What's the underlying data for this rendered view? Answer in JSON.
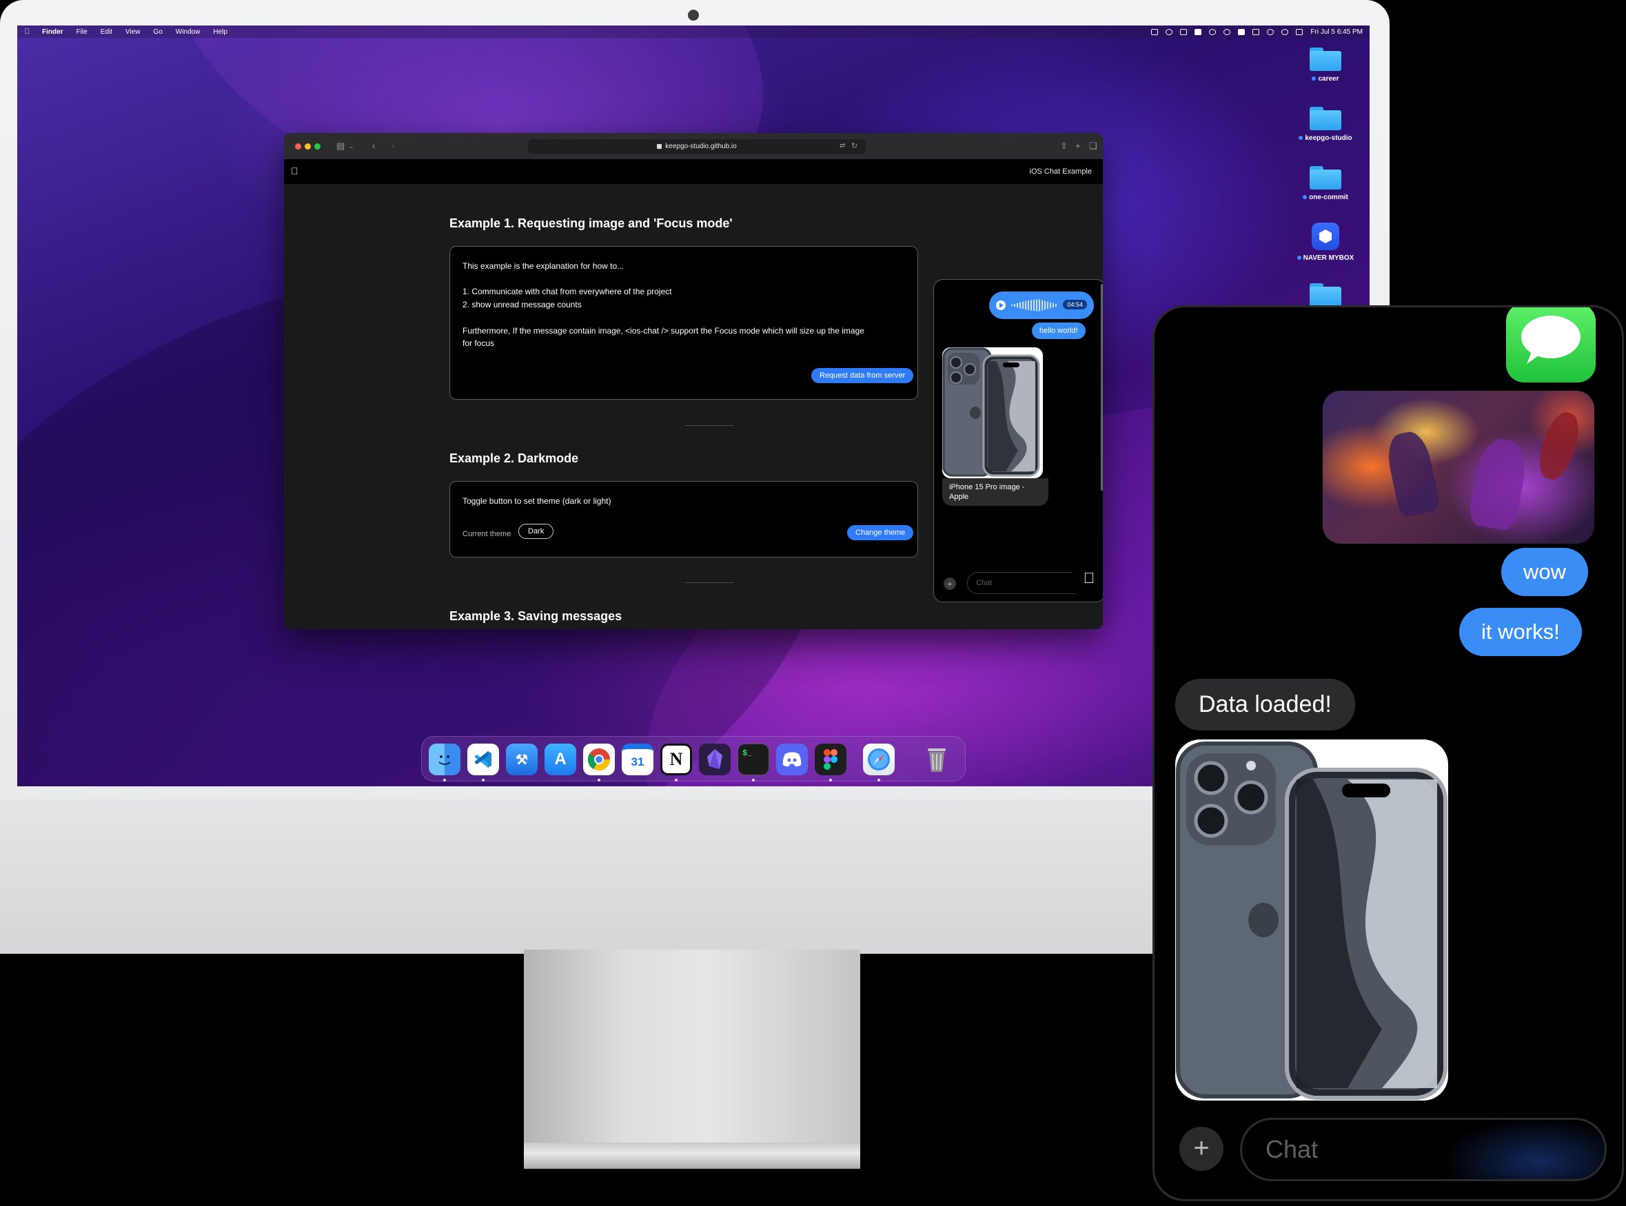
{
  "menubar": {
    "app": "Finder",
    "items": [
      "File",
      "Edit",
      "View",
      "Go",
      "Window",
      "Help"
    ],
    "clock": "Fri Jul 5  6:45 PM"
  },
  "desktop": {
    "items": [
      "career",
      "keepgo-studio",
      "one-commit",
      "NAVER MYBOX"
    ]
  },
  "safari": {
    "url": "keepgo-studio.github.io",
    "nav_title": "iOS Chat Example"
  },
  "examples": {
    "ex1": {
      "heading": "Example 1. Requesting image and 'Focus mode'",
      "line1": "This example is the explanation for how to...",
      "line2": "1. Communicate with chat from everywhere of the project",
      "line3": "2. show unread message counts",
      "line4": "Furthermore, If the message contain image, <ios-chat /> support the Focus mode which will size up the image",
      "line5": "for focus",
      "button": "Request data from server"
    },
    "ex2": {
      "heading": "Example 2. Darkmode",
      "description": "Toggle button to set theme (dark or light)",
      "current_label": "Current theme",
      "current_value": "Dark",
      "button": "Change theme"
    },
    "ex3": {
      "heading": "Example 3. Saving messages"
    }
  },
  "mini_chat": {
    "voice_duration": "04:54",
    "hello": "hello world!",
    "image_caption": "iPhone 15 Pro image - Apple",
    "input_placeholder": "Chat"
  },
  "dock": {
    "apps": [
      "finder",
      "vscode",
      "xcode",
      "app-store",
      "chrome",
      "calendar",
      "notion",
      "obsidian",
      "terminal",
      "discord",
      "figma",
      "safari",
      "trash"
    ],
    "calendar_day": "31",
    "notion_letter": "N",
    "terminal_prompt": "$_"
  },
  "phone_chat": {
    "messages": [
      "wow",
      "it works!",
      "Data loaded!"
    ],
    "input_placeholder": "Chat"
  },
  "colors": {
    "bubble_blue": "#3a8df5",
    "button_blue": "#2f7bf6",
    "bubble_gray": "#2b2b2d",
    "messages_green": "#34c759"
  }
}
